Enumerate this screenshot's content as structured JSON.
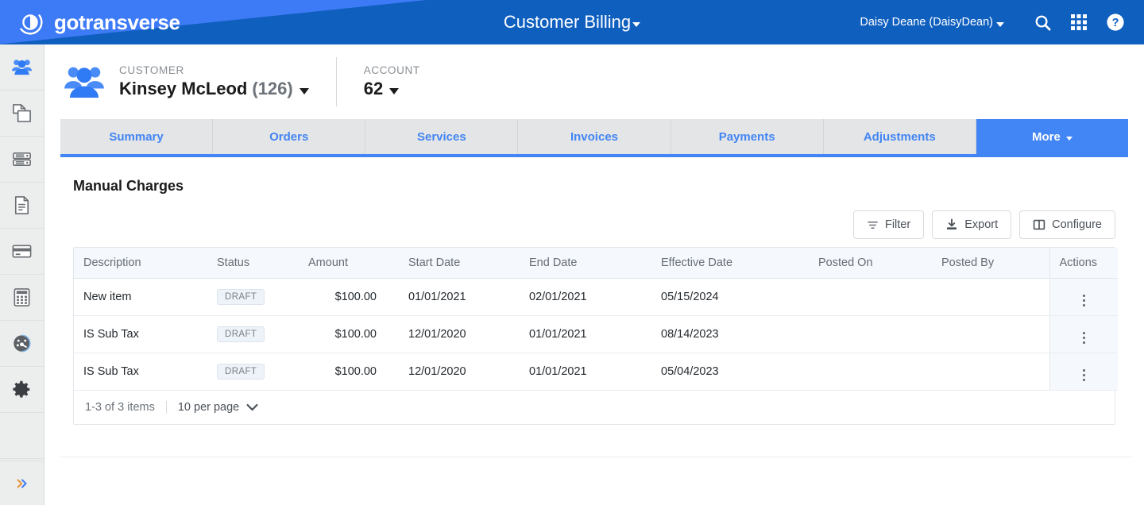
{
  "brand": {
    "name": "gotransverse",
    "logo_icon": "gotransverse-circle-logo"
  },
  "header": {
    "app_title": "Customer Billing",
    "app_title_caret": "chevron-down-icon",
    "user_menu": "Daisy Deane (DaisyDean)",
    "icons": [
      {
        "name": "search-icon",
        "label": "Search"
      },
      {
        "name": "apps-grid-icon",
        "label": "Apps"
      },
      {
        "name": "help-circle-icon",
        "label": "Help"
      }
    ],
    "colors": {
      "primary": "#0f5fbf",
      "accent": "#3d7af5",
      "tab_active": "#4285f4"
    }
  },
  "sidebar": {
    "items": [
      {
        "name": "customers-icon",
        "label": "Customers",
        "active": true
      },
      {
        "name": "copy-documents-icon",
        "label": "Products",
        "active": false
      },
      {
        "name": "server-stack-icon",
        "label": "Catalog",
        "active": false
      },
      {
        "name": "document-icon",
        "label": "Invoices",
        "active": false
      },
      {
        "name": "credit-card-icon",
        "label": "Payments",
        "active": false
      },
      {
        "name": "calculator-icon",
        "label": "Billing",
        "active": false
      },
      {
        "name": "gauge-dashboard-icon",
        "label": "Reports",
        "active": false
      },
      {
        "name": "gear-settings-icon",
        "label": "Settings",
        "active": false
      }
    ],
    "expand_icon": "double-chevron-right-icon"
  },
  "context": {
    "customer_label": "CUSTOMER",
    "customer_name": "Kinsey McLeod",
    "customer_id": "(126)",
    "account_label": "ACCOUNT",
    "account_value": "62",
    "customer_icon": "group-people-icon"
  },
  "tabs": [
    {
      "label": "Summary",
      "active": false
    },
    {
      "label": "Orders",
      "active": false
    },
    {
      "label": "Services",
      "active": false
    },
    {
      "label": "Invoices",
      "active": false
    },
    {
      "label": "Payments",
      "active": false
    },
    {
      "label": "Adjustments",
      "active": false
    },
    {
      "label": "More",
      "active": true
    }
  ],
  "page": {
    "title": "Manual Charges"
  },
  "toolbar": {
    "filter_label": "Filter",
    "export_label": "Export",
    "configure_label": "Configure",
    "filter_icon": "filter-lines-icon",
    "export_icon": "download-tray-icon",
    "configure_icon": "columns-icon"
  },
  "table": {
    "columns": [
      "Description",
      "Status",
      "Amount",
      "Start Date",
      "End Date",
      "Effective Date",
      "Posted On",
      "Posted By",
      "Actions"
    ],
    "rows": [
      {
        "description": "New item",
        "status": "DRAFT",
        "amount": "$100.00",
        "start_date": "01/01/2021",
        "end_date": "02/01/2021",
        "effective_date": "05/15/2024",
        "posted_on": "",
        "posted_by": "",
        "actions_icon": "kebab-menu-icon"
      },
      {
        "description": "IS Sub Tax",
        "status": "DRAFT",
        "amount": "$100.00",
        "start_date": "12/01/2020",
        "end_date": "01/01/2021",
        "effective_date": "08/14/2023",
        "posted_on": "",
        "posted_by": "",
        "actions_icon": "kebab-menu-icon"
      },
      {
        "description": "IS Sub Tax",
        "status": "DRAFT",
        "amount": "$100.00",
        "start_date": "12/01/2020",
        "end_date": "01/01/2021",
        "effective_date": "05/04/2023",
        "posted_on": "",
        "posted_by": "",
        "actions_icon": "kebab-menu-icon"
      }
    ],
    "footer": {
      "range_text": "1-3 of 3 items",
      "per_page_text": "10 per page",
      "per_page_icon": "chevron-down-icon"
    }
  }
}
